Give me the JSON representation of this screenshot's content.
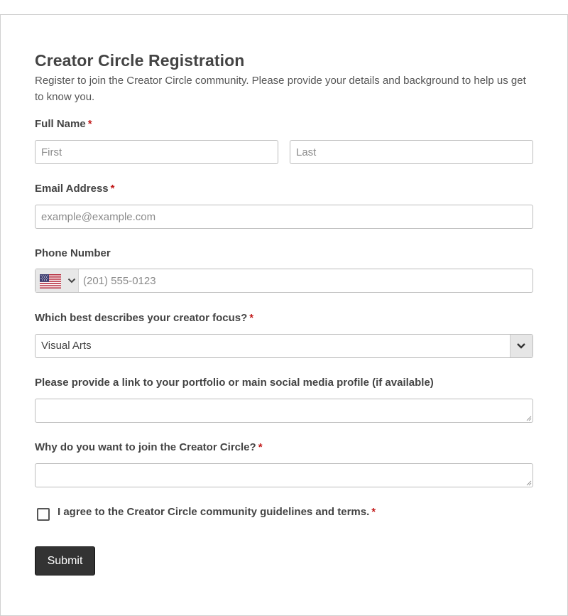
{
  "form": {
    "title": "Creator Circle Registration",
    "description": "Register to join the Creator Circle community. Please provide your details and background to help us get to know you.",
    "required_marker": "*",
    "full_name": {
      "label": "Full Name",
      "first_placeholder": "First",
      "last_placeholder": "Last"
    },
    "email": {
      "label": "Email Address",
      "placeholder": "example@example.com"
    },
    "phone": {
      "label": "Phone Number",
      "country": "us-flag-icon",
      "placeholder": "(201) 555-0123"
    },
    "creator_focus": {
      "label": "Which best describes your creator focus?",
      "selected": "Visual Arts"
    },
    "portfolio": {
      "label": "Please provide a link to your portfolio or main social media profile (if available)"
    },
    "why_join": {
      "label": "Why do you want to join the Creator Circle?"
    },
    "agree": {
      "label": "I agree to the Creator Circle community guidelines and terms.",
      "checked": false
    },
    "submit_label": "Submit"
  },
  "colors": {
    "required": "#c21a1a",
    "button_bg": "#333333",
    "text": "#444444",
    "border": "#bcbcbc"
  }
}
